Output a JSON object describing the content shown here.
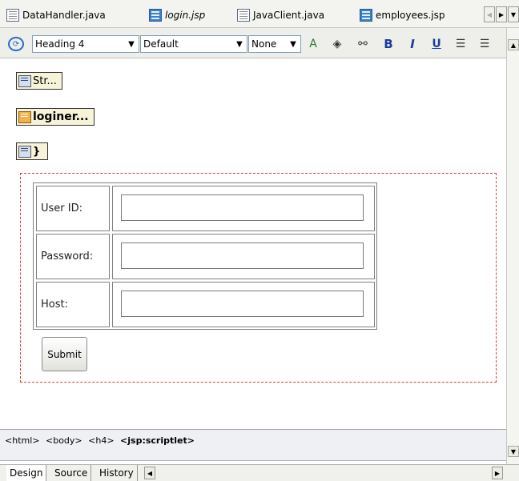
{
  "tabs": [
    {
      "label": "DataHandler.java",
      "icon": "java-file-icon"
    },
    {
      "label": "login.jsp",
      "icon": "jsp-file-icon",
      "active": true
    },
    {
      "label": "JavaClient.java",
      "icon": "java-file-icon"
    },
    {
      "label": "employees.jsp",
      "icon": "jsp-file-icon"
    }
  ],
  "toolbar": {
    "block_format": "Heading 4",
    "font": "Default",
    "size": "None",
    "bold_label": "B",
    "italic_label": "I",
    "underline_label": "U"
  },
  "canvas": {
    "chips": [
      {
        "label": "Str...",
        "icon": "scriptlet-icon"
      },
      {
        "label": "loginer...",
        "icon": "usebean-icon"
      },
      {
        "label": "}",
        "icon": "scriptlet-icon"
      }
    ],
    "form": {
      "rows": [
        {
          "label": "User ID:",
          "value": ""
        },
        {
          "label": "Password:",
          "value": ""
        },
        {
          "label": "Host:",
          "value": ""
        }
      ],
      "submit_label": "Submit"
    }
  },
  "breadcrumb": {
    "items": [
      "<html>",
      "<body>",
      "<h4>"
    ],
    "current": "<jsp:scriptlet>"
  },
  "bottom_tabs": [
    {
      "label": "Design",
      "active": true
    },
    {
      "label": "Source"
    },
    {
      "label": "History"
    }
  ],
  "colors": {
    "form_region_border": "#e23a3a",
    "format_buttons": "#1a3c9c"
  }
}
